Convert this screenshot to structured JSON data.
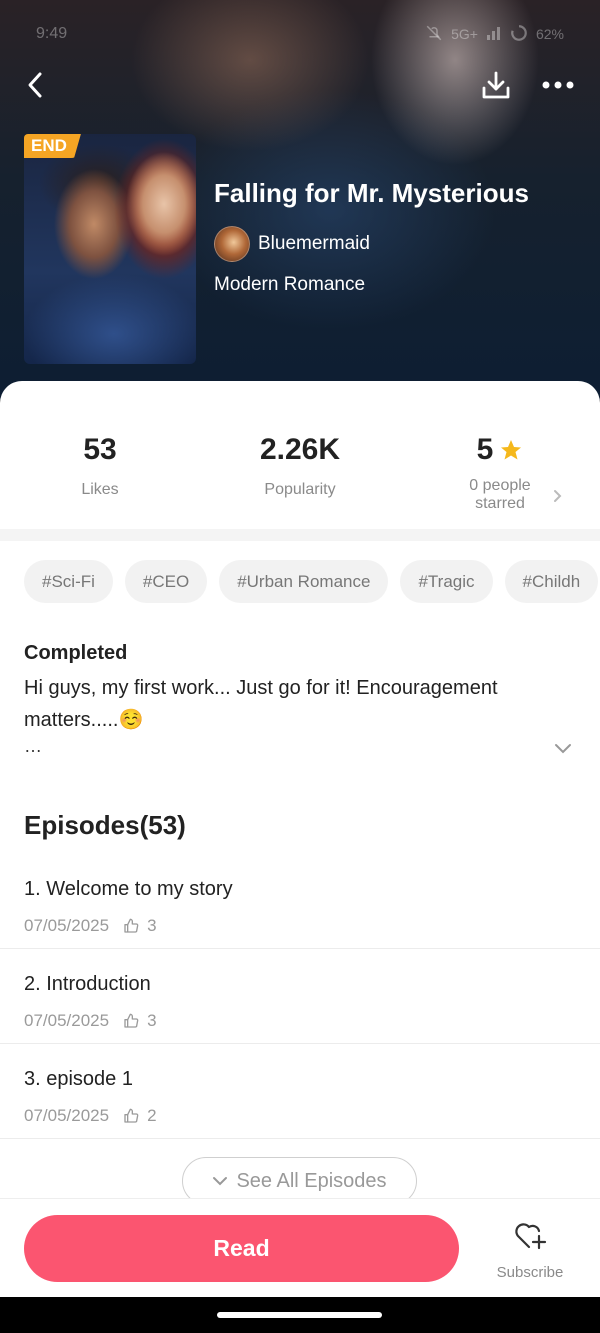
{
  "status_bar": {
    "time": "9:49",
    "network": "5G+",
    "battery": "62%"
  },
  "header": {
    "back_icon": "chevron-left-icon",
    "download_icon": "download-icon",
    "more_icon": "more-horizontal-icon"
  },
  "book": {
    "badge": "END",
    "title": "Falling for Mr. Mysterious",
    "author": "Bluemermaid",
    "genre": "Modern Romance"
  },
  "stats": {
    "likes_value": "53",
    "likes_label": "Likes",
    "popularity_value": "2.26K",
    "popularity_label": "Popularity",
    "rating_value": "5",
    "rating_label": "0 people starred",
    "star_color": "#f5b81c"
  },
  "tags": [
    "#Sci-Fi",
    "#CEO",
    "#Urban Romance",
    "#Tragic",
    "#Childh"
  ],
  "description": {
    "status": "Completed",
    "text": "Hi guys, my first work... Just go for it! Encouragement matters.....☺️",
    "ellipsis": "…"
  },
  "episodes": {
    "title": "Episodes(53)",
    "items": [
      {
        "title": "1. Welcome to my story",
        "date": "07/05/2025",
        "likes": "3"
      },
      {
        "title": "2. Introduction",
        "date": "07/05/2025",
        "likes": "3"
      },
      {
        "title": "3. episode 1",
        "date": "07/05/2025",
        "likes": "2"
      }
    ],
    "see_all_label": "See All Episodes"
  },
  "actions": {
    "read_label": "Read",
    "subscribe_label": "Subscribe",
    "accent_color": "#fb5570"
  }
}
